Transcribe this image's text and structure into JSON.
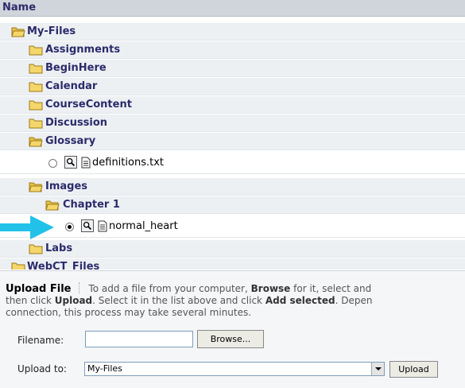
{
  "tree": {
    "header": "Name",
    "root": "My-Files",
    "folders": {
      "assignments": "Assignments",
      "beginhere": "BeginHere",
      "calendar": "Calendar",
      "coursecontent": "CourseContent",
      "discussion": "Discussion",
      "glossary": "Glossary",
      "images": "Images",
      "chapter1": "Chapter 1",
      "labs": "Labs",
      "webct": "WebCT_Files"
    },
    "files": {
      "definitions": "definitions.txt",
      "normal_heart": "normal_heart"
    },
    "selected_file": "normal_heart"
  },
  "upload": {
    "title": "Upload File",
    "desc_1": "To add a file from your computer,",
    "desc_browse": "Browse",
    "desc_2": "for it, select and",
    "desc_3": "then click",
    "desc_upload": "Upload",
    "desc_4": ". Select it in the list above and click",
    "desc_add": "Add selected",
    "desc_5": ". Depen",
    "desc_6": "connection, this process may take several minutes.",
    "filename_label": "Filename:",
    "filename_value": "",
    "browse_button": "Browse...",
    "upload_to_label": "Upload to:",
    "upload_to_value": "My-Files",
    "upload_button": "Upload"
  },
  "colors": {
    "folder_fill": "#f5d66a",
    "folder_stroke": "#9a7a1a",
    "arrow": "#22c2e8",
    "header_bg": "#d0d4db",
    "folder_text": "#2b2b6b"
  },
  "icons": [
    "folder-open-icon",
    "folder-icon",
    "magnifier-icon",
    "document-icon",
    "radio-button",
    "pointer-arrow",
    "dropdown-arrow-icon"
  ]
}
